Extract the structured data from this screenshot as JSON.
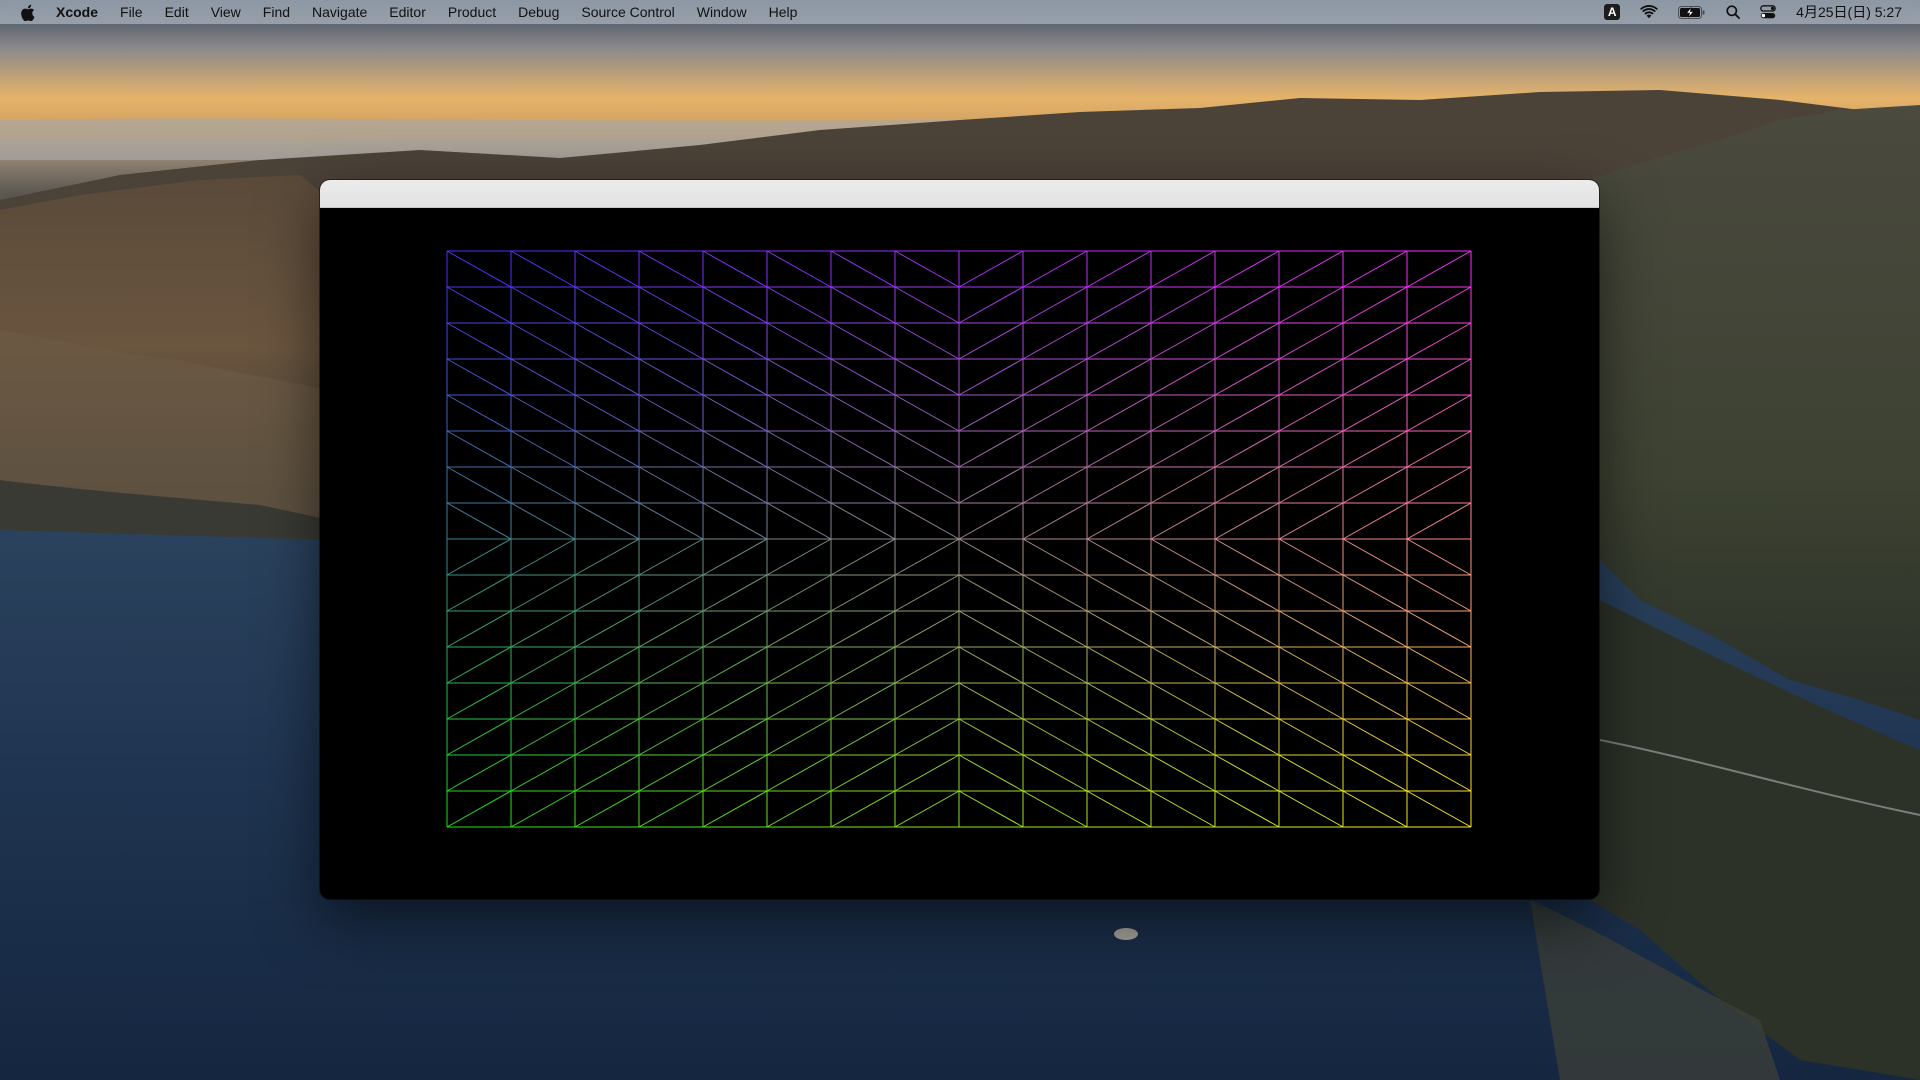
{
  "menubar": {
    "app_name": "Xcode",
    "items": [
      "File",
      "Edit",
      "View",
      "Find",
      "Navigate",
      "Editor",
      "Product",
      "Debug",
      "Source Control",
      "Window",
      "Help"
    ],
    "input_source": "A",
    "clock": "4月25日(日)  5:27",
    "icons": [
      "apple-icon",
      "input-source-icon",
      "wifi-icon",
      "battery-charging-icon",
      "search-icon",
      "control-center-icon"
    ]
  },
  "window": {
    "title": "",
    "background": "#000000"
  },
  "mesh": {
    "columns": 16,
    "rows": 16,
    "colors": {
      "top_left": "#4a2bff",
      "top_right": "#ff2bff",
      "bottom_left": "#22e01a",
      "bottom_right": "#ffef1a"
    }
  }
}
